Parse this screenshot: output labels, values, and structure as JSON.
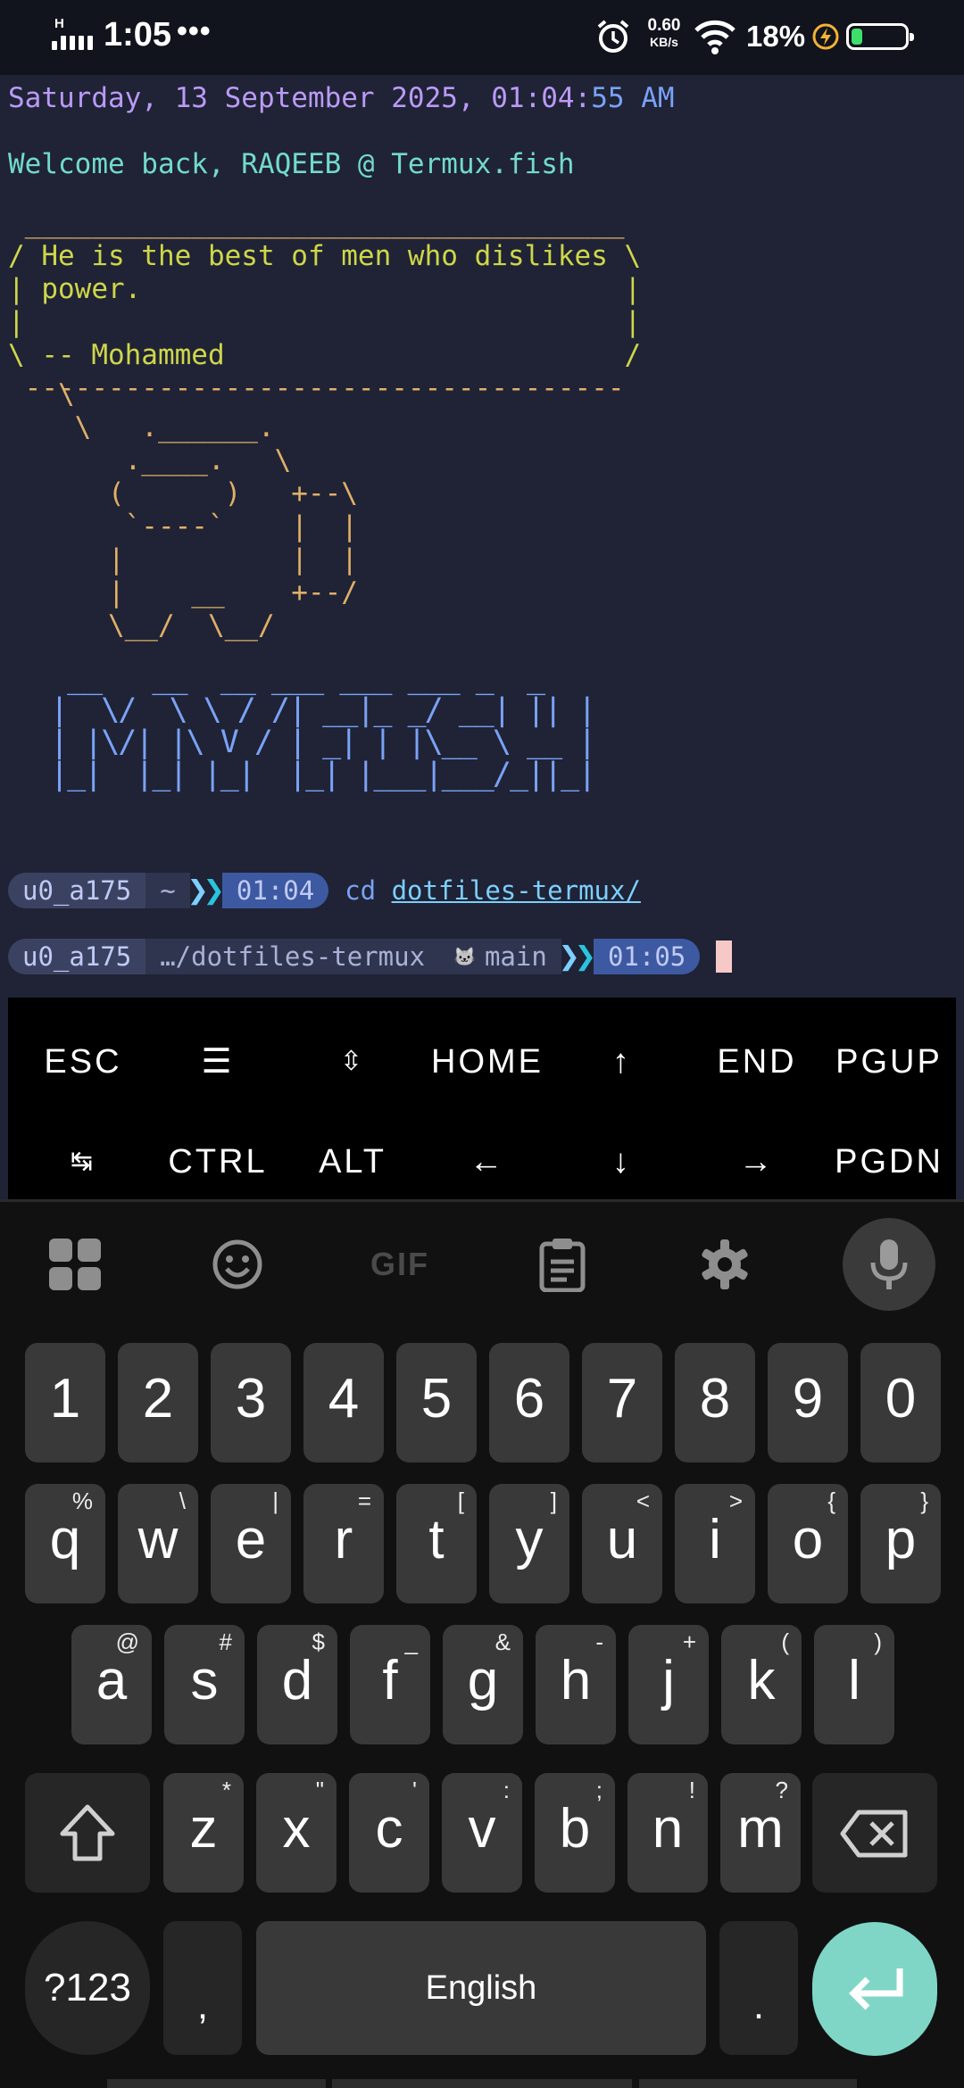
{
  "status_bar": {
    "signal_letter": "H",
    "time": "1:05",
    "overflow": "•••",
    "net_speed_value": "0.60",
    "net_speed_unit": "KB/s",
    "battery_percent": "18%",
    "battery_level": 0.18,
    "icons": [
      "signal-icon",
      "alarm-icon",
      "wifi-icon",
      "charging-bolt-icon",
      "battery-icon"
    ]
  },
  "terminal": {
    "date_prefix": "Saturday, 13 September 2025, 01:04:",
    "date_seconds": "55 AM",
    "welcome": "Welcome back, RAQEEB @ Termux.fish",
    "cowsay_top": " ____________________________________",
    "cowsay_lines": [
      "/ He is the best of men who dislikes \\",
      "| power.                             |",
      "|                                    |",
      "\\ -- Mohammed                        /"
    ],
    "cowsay_bottom": " ------------------------------------",
    "fish_art": "   \\\n    \\   .______.\n       .____.   \\\n      (      )   +--\\\n       `----`    |  |\n      |          |  |\n      |    __    +--/\n      \\__/  \\__/",
    "banner_art": " __   __  __ ___ ___ ___ _  _\n|  \\/  \\ \\ / /| __|_ _/ __| || |\n| |\\/| |\\ V / | _| | |\\__ \\ __ |\n|_|  |_| |_|  |_| |___|___/_||_|",
    "prompt1": {
      "user": "u0_a175",
      "dir": "~",
      "time": "01:04",
      "command": "cd",
      "argument": "dotfiles-termux/"
    },
    "prompt2": {
      "user": "u0_a175",
      "dir": "…/dotfiles-termux",
      "git_icon": "🐱",
      "branch": "main",
      "time": "01:05"
    }
  },
  "extra_keys": {
    "row1": [
      "ESC",
      "☰",
      "⇳",
      "HOME",
      "↑",
      "END",
      "PGUP"
    ],
    "row2": [
      "↹",
      "CTRL",
      "ALT",
      "←",
      "↓",
      "→",
      "PGDN"
    ]
  },
  "keyboard": {
    "toolbar": [
      "apps-icon",
      "emoji-icon",
      "gif-icon",
      "clipboard-icon",
      "settings-icon",
      "mic-icon"
    ],
    "gif_label": "GIF",
    "numbers": [
      "1",
      "2",
      "3",
      "4",
      "5",
      "6",
      "7",
      "8",
      "9",
      "0"
    ],
    "row_q": [
      {
        "k": "q",
        "s": "%"
      },
      {
        "k": "w",
        "s": "\\"
      },
      {
        "k": "e",
        "s": "|"
      },
      {
        "k": "r",
        "s": "="
      },
      {
        "k": "t",
        "s": "["
      },
      {
        "k": "y",
        "s": "]"
      },
      {
        "k": "u",
        "s": "<"
      },
      {
        "k": "i",
        "s": ">"
      },
      {
        "k": "o",
        "s": "{"
      },
      {
        "k": "p",
        "s": "}"
      }
    ],
    "row_a": [
      {
        "k": "a",
        "s": "@"
      },
      {
        "k": "s",
        "s": "#"
      },
      {
        "k": "d",
        "s": "$"
      },
      {
        "k": "f",
        "s": "_"
      },
      {
        "k": "g",
        "s": "&"
      },
      {
        "k": "h",
        "s": "-"
      },
      {
        "k": "j",
        "s": "+"
      },
      {
        "k": "k",
        "s": "("
      },
      {
        "k": "l",
        "s": ")"
      }
    ],
    "row_z": [
      {
        "k": "z",
        "s": "*"
      },
      {
        "k": "x",
        "s": "\""
      },
      {
        "k": "c",
        "s": "'"
      },
      {
        "k": "v",
        "s": ":"
      },
      {
        "k": "b",
        "s": ";"
      },
      {
        "k": "n",
        "s": "!"
      },
      {
        "k": "m",
        "s": "?"
      }
    ],
    "symbols_label": "?123",
    "comma": ",",
    "space_label": "English",
    "period": ".",
    "accent_color": "#7fd6c6"
  }
}
